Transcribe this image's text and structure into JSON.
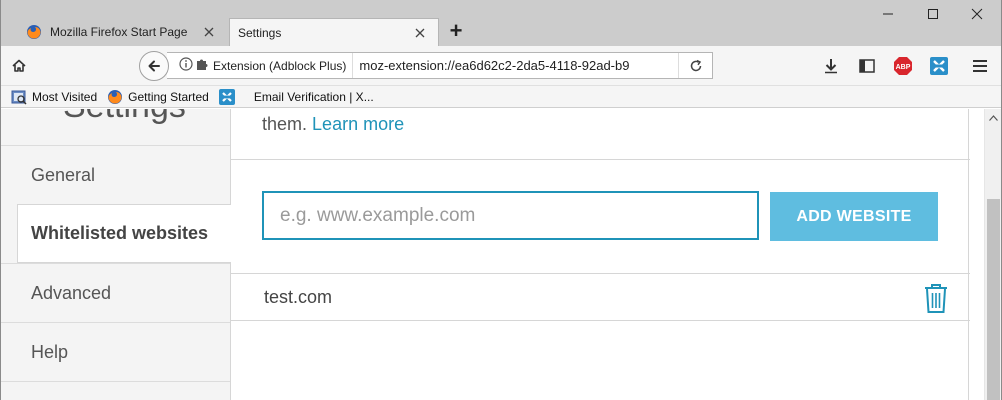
{
  "browser": {
    "tabs": [
      {
        "title": "Mozilla Firefox Start Page",
        "active": false,
        "icon": "firefox-icon"
      },
      {
        "title": "Settings",
        "active": true
      }
    ],
    "newtab_label": "+",
    "window_controls": [
      "minimize",
      "maximize",
      "close"
    ],
    "urlbar": {
      "identity_label": "Extension (Adblock Plus)",
      "url": "moz-extension://ea6d62c2-2da5-4118-92ad-b9"
    },
    "toolbar_icons": [
      "download-icon",
      "sidebar-icon",
      "adblock-plus-icon",
      "extension-icon",
      "menu-icon"
    ],
    "abp_label": "ABP"
  },
  "bookmarks": [
    {
      "label": "Most Visited",
      "icon": "most-visited-icon"
    },
    {
      "label": "Getting Started",
      "icon": "firefox-icon"
    },
    {
      "label": "",
      "icon": "extension-icon"
    },
    {
      "label": "Email Verification | X...",
      "icon": "none"
    }
  ],
  "sidebar": {
    "heading": "Settings",
    "items": [
      {
        "label": "General",
        "active": false
      },
      {
        "label": "Whitelisted websites",
        "active": true
      },
      {
        "label": "Advanced",
        "active": false
      },
      {
        "label": "Help",
        "active": false
      }
    ]
  },
  "main": {
    "intro_text": "them.",
    "learn_more": "Learn more",
    "input_placeholder": "e.g. www.example.com",
    "add_button": "ADD WEBSITE",
    "whitelist": [
      "test.com"
    ]
  },
  "colors": {
    "accent": "#1f93b8",
    "button": "#5fbde0",
    "sidebar_bg": "#f4f4f4"
  }
}
